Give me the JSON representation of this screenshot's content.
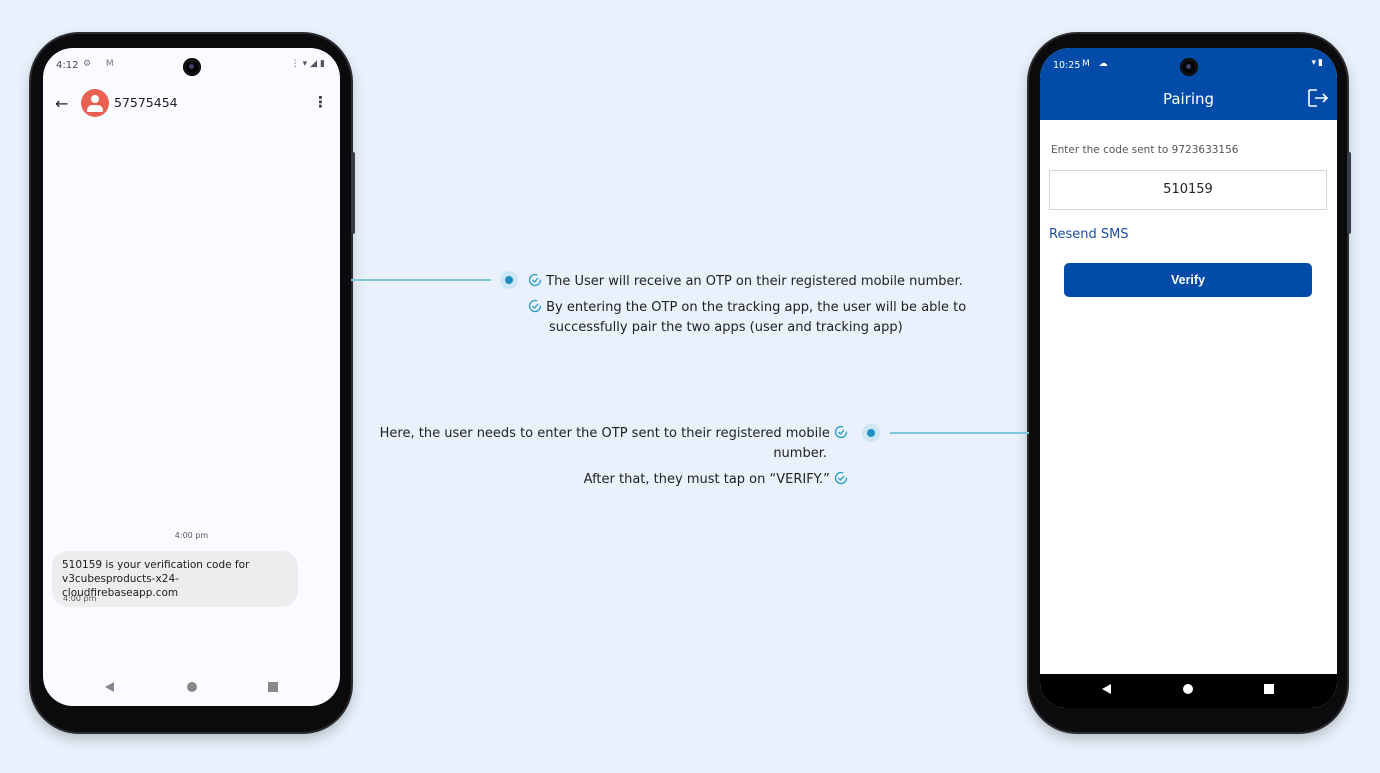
{
  "left_phone": {
    "statusbar": {
      "time": "4:12",
      "left_icons": "⚙ M",
      "right_icons": "⋮▾◢▮"
    },
    "header": {
      "contact": "57575454",
      "back_icon": "←",
      "menu_icon": "⋮"
    },
    "messages": {
      "center_timestamp": "4:00 pm",
      "bubble_line1": "510159 is your verification code for",
      "bubble_line2": "v3cubesproducts-x24-cloudfirebaseapp.com",
      "bubble_timestamp": "4:00 pm"
    }
  },
  "right_phone": {
    "statusbar": {
      "time": "10:25",
      "left_icons": "M ☁",
      "right_icons": "▾▮"
    },
    "header": {
      "title": "Pairing"
    },
    "form": {
      "label": "Enter the code  sent to  9723633156",
      "code_value": "510159",
      "resend_label": "Resend SMS",
      "verify_label": "Verify"
    }
  },
  "annotations": {
    "top": {
      "items": [
        "The User will receive an OTP on their registered mobile number.",
        "By entering the OTP on the tracking app, the user will be able to",
        "successfully pair the two apps (user and tracking app)"
      ]
    },
    "bottom": {
      "line1": "Here, the user needs to enter the OTP sent to their registered mobile",
      "line1b": "number.",
      "line2": "After that, they must tap on “VERIFY.”"
    }
  },
  "colors": {
    "brand": "#034ba8",
    "accent": "#1e8fc2",
    "background": "#e8f1fc"
  }
}
